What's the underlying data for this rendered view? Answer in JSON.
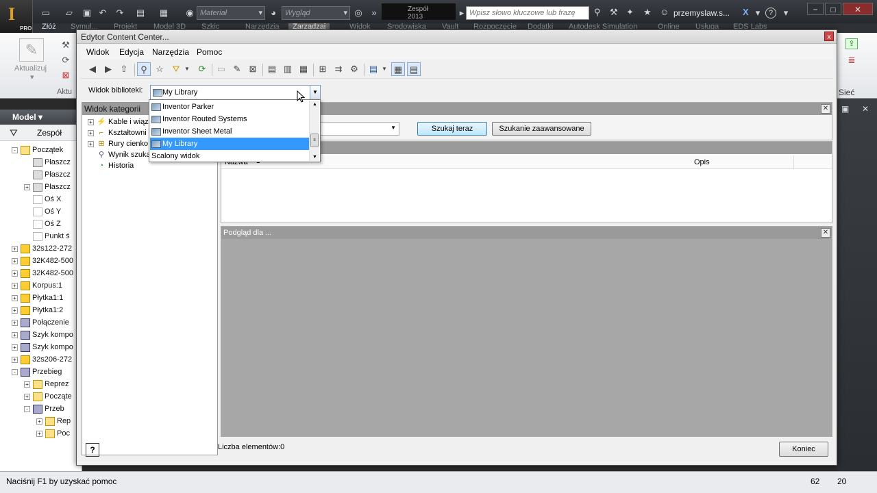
{
  "app": {
    "logo_letter": "I",
    "logo_suffix": "PRO",
    "material_placeholder": "Materiał",
    "appearance_placeholder": "Wygląd",
    "team_field": "Zespół 2013",
    "search_placeholder": "Wpisz słowo kluczowe lub frazę",
    "username": "przemyslaw.s...",
    "help": "?"
  },
  "ribbon": {
    "tab_zloz": "Złóż",
    "tabs_partial": [
      "Symul...",
      "Projekt",
      "Model 3D",
      "Szkic",
      "Narzędzia",
      "Zarządzaj",
      "Widok",
      "Środowiska",
      "Vault",
      "Rozpoczęcie",
      "Dodatki",
      "Autodesk Simulation",
      "Online",
      "Usługa",
      "EDS Labs"
    ],
    "update_label": "Aktualizuj",
    "panel_label": "Aktu",
    "siec_label": "Sieć"
  },
  "browser": {
    "title": "Model",
    "tool_label": "Zespół",
    "nodes": [
      {
        "label": "Początek",
        "expander": "-",
        "icon": "folder-icon",
        "level": 1
      },
      {
        "label": "Płaszcz",
        "expander": "",
        "icon": "plane-icon",
        "level": 2
      },
      {
        "label": "Płaszcz",
        "expander": "",
        "icon": "plane-icon",
        "level": 2
      },
      {
        "label": "Płaszcz",
        "expander": "+",
        "icon": "plane-icon",
        "level": 2
      },
      {
        "label": "Oś X",
        "expander": "",
        "icon": "axis-icon",
        "level": 2
      },
      {
        "label": "Oś Y",
        "expander": "",
        "icon": "axis-icon",
        "level": 2
      },
      {
        "label": "Oś Z",
        "expander": "",
        "icon": "axis-icon",
        "level": 2
      },
      {
        "label": "Punkt ś",
        "expander": "",
        "icon": "point-icon",
        "level": 2
      },
      {
        "label": "32s122-272",
        "expander": "+",
        "icon": "part-icon",
        "level": 1
      },
      {
        "label": "32K482-500",
        "expander": "+",
        "icon": "part-icon",
        "level": 1
      },
      {
        "label": "32K482-500",
        "expander": "+",
        "icon": "part-icon",
        "level": 1
      },
      {
        "label": "Korpus:1",
        "expander": "+",
        "icon": "part-icon",
        "level": 1
      },
      {
        "label": "Płytka1:1",
        "expander": "+",
        "icon": "part-icon",
        "level": 1
      },
      {
        "label": "Płytka1:2",
        "expander": "+",
        "icon": "part-icon",
        "level": 1
      },
      {
        "label": "Połączenie",
        "expander": "+",
        "icon": "assembly-icon",
        "level": 1
      },
      {
        "label": "Szyk kompo",
        "expander": "+",
        "icon": "pattern-icon",
        "level": 1
      },
      {
        "label": "Szyk kompo",
        "expander": "+",
        "icon": "pattern-icon",
        "level": 1
      },
      {
        "label": "32s206-272",
        "expander": "+",
        "icon": "part-icon",
        "level": 1
      },
      {
        "label": "Przebieg",
        "expander": "-",
        "icon": "route-icon",
        "level": 1
      },
      {
        "label": "Reprez",
        "expander": "+",
        "icon": "representation-icon",
        "level": 2
      },
      {
        "label": "Począte",
        "expander": "+",
        "icon": "folder-icon",
        "level": 2
      },
      {
        "label": "Przeb",
        "expander": "-",
        "icon": "route-icon",
        "level": 2
      },
      {
        "label": "Rep",
        "expander": "+",
        "icon": "representation-icon",
        "level": 3
      },
      {
        "label": "Poc",
        "expander": "+",
        "icon": "folder-icon",
        "level": 3
      }
    ]
  },
  "status": {
    "text": "Naciśnij F1 by uzyskać pomoc",
    "n1": "62",
    "n2": "20"
  },
  "dialog": {
    "title": "Edytor Content Center...",
    "close": "x",
    "menu": [
      "Widok",
      "Edycja",
      "Narzędzia",
      "Pomoc"
    ],
    "library_label": "Widok biblioteki:",
    "library_value": "My Library",
    "categories_title": "Widok kategorii",
    "categories": [
      {
        "label": "Kable i wiąz",
        "expander": "+"
      },
      {
        "label": "Kształtowni",
        "expander": "+"
      },
      {
        "label": "Rury cienko",
        "expander": "+"
      },
      {
        "label": "Wynik szuka",
        "expander": ""
      },
      {
        "label": "Historia",
        "expander": ""
      }
    ],
    "search_now": "Szukaj teraz",
    "advanced_search": "Szukanie zaawansowane",
    "col_name": "Nazwa",
    "col_desc": "Opis",
    "preview_title": "Podgląd dla ...",
    "count_label": "Liczba elementów:0",
    "close_button": "Koniec",
    "help_icon": "?"
  },
  "dropdown": {
    "items": [
      {
        "label": "Inventor Parker",
        "selected": false
      },
      {
        "label": "Inventor Routed Systems",
        "selected": false
      },
      {
        "label": "Inventor Sheet Metal",
        "selected": false
      },
      {
        "label": "My Library",
        "selected": true
      },
      {
        "label": "Scalony widok",
        "selected": false
      }
    ]
  },
  "colors": {
    "selection": "#3399ff",
    "panel_header": "#9a9a9a",
    "preview_bg": "#a7a7a7"
  }
}
